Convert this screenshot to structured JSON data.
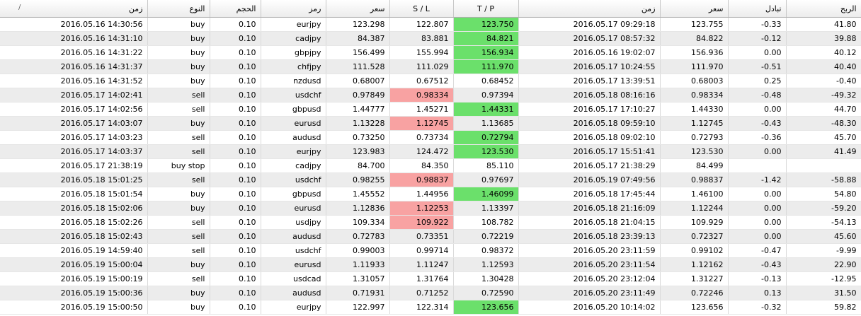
{
  "colors": {
    "tp_hit": "#6be06b",
    "sl_hit": "#f8a2a2",
    "row_alt": "#ececec"
  },
  "headers": {
    "open_time": "زمن",
    "type": "النوع",
    "volume": "الحجم",
    "symbol": "رمز",
    "open_price": "سعر",
    "sl": "S / L",
    "tp": "T / P",
    "close_time": "زمن",
    "close_price": "سعر",
    "swap": "تبادل",
    "profit": "الربح"
  },
  "sort_indicator": "/",
  "rows": [
    {
      "open_time": "2016.05.16 14:30:56",
      "type": "buy",
      "volume": "0.10",
      "symbol": "eurjpy",
      "open_price": "123.298",
      "sl": "122.807",
      "tp": "123.750",
      "close_time": "2016.05.17 09:29:18",
      "close_price": "123.755",
      "swap": "-0.33",
      "profit": "41.80",
      "hit": "tp"
    },
    {
      "open_time": "2016.05.16 14:31:10",
      "type": "buy",
      "volume": "0.10",
      "symbol": "cadjpy",
      "open_price": "84.387",
      "sl": "83.881",
      "tp": "84.821",
      "close_time": "2016.05.17 08:57:32",
      "close_price": "84.822",
      "swap": "-0.12",
      "profit": "39.88",
      "hit": "tp"
    },
    {
      "open_time": "2016.05.16 14:31:22",
      "type": "buy",
      "volume": "0.10",
      "symbol": "gbpjpy",
      "open_price": "156.499",
      "sl": "155.994",
      "tp": "156.934",
      "close_time": "2016.05.16 19:02:07",
      "close_price": "156.936",
      "swap": "0.00",
      "profit": "40.12",
      "hit": "tp"
    },
    {
      "open_time": "2016.05.16 14:31:37",
      "type": "buy",
      "volume": "0.10",
      "symbol": "chfjpy",
      "open_price": "111.528",
      "sl": "111.029",
      "tp": "111.970",
      "close_time": "2016.05.17 10:24:55",
      "close_price": "111.970",
      "swap": "-0.51",
      "profit": "40.40",
      "hit": "tp"
    },
    {
      "open_time": "2016.05.16 14:31:52",
      "type": "buy",
      "volume": "0.10",
      "symbol": "nzdusd",
      "open_price": "0.68007",
      "sl": "0.67512",
      "tp": "0.68452",
      "close_time": "2016.05.17 13:39:51",
      "close_price": "0.68003",
      "swap": "0.25",
      "profit": "-0.40",
      "hit": ""
    },
    {
      "open_time": "2016.05.17 14:02:41",
      "type": "sell",
      "volume": "0.10",
      "symbol": "usdchf",
      "open_price": "0.97849",
      "sl": "0.98334",
      "tp": "0.97394",
      "close_time": "2016.05.18 08:16:16",
      "close_price": "0.98334",
      "swap": "-0.48",
      "profit": "-49.32",
      "hit": "sl"
    },
    {
      "open_time": "2016.05.17 14:02:56",
      "type": "sell",
      "volume": "0.10",
      "symbol": "gbpusd",
      "open_price": "1.44777",
      "sl": "1.45271",
      "tp": "1.44331",
      "close_time": "2016.05.17 17:10:27",
      "close_price": "1.44330",
      "swap": "0.00",
      "profit": "44.70",
      "hit": "tp"
    },
    {
      "open_time": "2016.05.17 14:03:07",
      "type": "buy",
      "volume": "0.10",
      "symbol": "eurusd",
      "open_price": "1.13228",
      "sl": "1.12745",
      "tp": "1.13685",
      "close_time": "2016.05.18 09:59:10",
      "close_price": "1.12745",
      "swap": "-0.43",
      "profit": "-48.30",
      "hit": "sl"
    },
    {
      "open_time": "2016.05.17 14:03:23",
      "type": "sell",
      "volume": "0.10",
      "symbol": "audusd",
      "open_price": "0.73250",
      "sl": "0.73734",
      "tp": "0.72794",
      "close_time": "2016.05.18 09:02:10",
      "close_price": "0.72793",
      "swap": "-0.36",
      "profit": "45.70",
      "hit": "tp"
    },
    {
      "open_time": "2016.05.17 14:03:37",
      "type": "sell",
      "volume": "0.10",
      "symbol": "eurjpy",
      "open_price": "123.983",
      "sl": "124.472",
      "tp": "123.530",
      "close_time": "2016.05.17 15:51:41",
      "close_price": "123.530",
      "swap": "0.00",
      "profit": "41.49",
      "hit": "tp"
    },
    {
      "open_time": "2016.05.17 21:38:19",
      "type": "buy stop",
      "volume": "0.10",
      "symbol": "cadjpy",
      "open_price": "84.700",
      "sl": "84.350",
      "tp": "85.110",
      "close_time": "2016.05.17 21:38:29",
      "close_price": "84.499",
      "swap": "",
      "profit": "",
      "hit": ""
    },
    {
      "open_time": "2016.05.18 15:01:25",
      "type": "sell",
      "volume": "0.10",
      "symbol": "usdchf",
      "open_price": "0.98255",
      "sl": "0.98837",
      "tp": "0.97697",
      "close_time": "2016.05.19 07:49:56",
      "close_price": "0.98837",
      "swap": "-1.42",
      "profit": "-58.88",
      "hit": "sl"
    },
    {
      "open_time": "2016.05.18 15:01:54",
      "type": "buy",
      "volume": "0.10",
      "symbol": "gbpusd",
      "open_price": "1.45552",
      "sl": "1.44956",
      "tp": "1.46099",
      "close_time": "2016.05.18 17:45:44",
      "close_price": "1.46100",
      "swap": "0.00",
      "profit": "54.80",
      "hit": "tp"
    },
    {
      "open_time": "2016.05.18 15:02:06",
      "type": "buy",
      "volume": "0.10",
      "symbol": "eurusd",
      "open_price": "1.12836",
      "sl": "1.12253",
      "tp": "1.13397",
      "close_time": "2016.05.18 21:16:09",
      "close_price": "1.12244",
      "swap": "0.00",
      "profit": "-59.20",
      "hit": "sl"
    },
    {
      "open_time": "2016.05.18 15:02:26",
      "type": "sell",
      "volume": "0.10",
      "symbol": "usdjpy",
      "open_price": "109.334",
      "sl": "109.922",
      "tp": "108.782",
      "close_time": "2016.05.18 21:04:15",
      "close_price": "109.929",
      "swap": "0.00",
      "profit": "-54.13",
      "hit": "sl"
    },
    {
      "open_time": "2016.05.18 15:02:43",
      "type": "sell",
      "volume": "0.10",
      "symbol": "audusd",
      "open_price": "0.72783",
      "sl": "0.73351",
      "tp": "0.72219",
      "close_time": "2016.05.18 23:39:13",
      "close_price": "0.72327",
      "swap": "0.00",
      "profit": "45.60",
      "hit": ""
    },
    {
      "open_time": "2016.05.19 14:59:40",
      "type": "sell",
      "volume": "0.10",
      "symbol": "usdchf",
      "open_price": "0.99003",
      "sl": "0.99714",
      "tp": "0.98372",
      "close_time": "2016.05.20 23:11:59",
      "close_price": "0.99102",
      "swap": "-0.47",
      "profit": "-9.99",
      "hit": ""
    },
    {
      "open_time": "2016.05.19 15:00:04",
      "type": "buy",
      "volume": "0.10",
      "symbol": "eurusd",
      "open_price": "1.11933",
      "sl": "1.11247",
      "tp": "1.12593",
      "close_time": "2016.05.20 23:11:54",
      "close_price": "1.12162",
      "swap": "-0.43",
      "profit": "22.90",
      "hit": ""
    },
    {
      "open_time": "2016.05.19 15:00:19",
      "type": "sell",
      "volume": "0.10",
      "symbol": "usdcad",
      "open_price": "1.31057",
      "sl": "1.31764",
      "tp": "1.30428",
      "close_time": "2016.05.20 23:12:04",
      "close_price": "1.31227",
      "swap": "-0.13",
      "profit": "-12.95",
      "hit": ""
    },
    {
      "open_time": "2016.05.19 15:00:36",
      "type": "buy",
      "volume": "0.10",
      "symbol": "audusd",
      "open_price": "0.71931",
      "sl": "0.71252",
      "tp": "0.72590",
      "close_time": "2016.05.20 23:11:49",
      "close_price": "0.72246",
      "swap": "0.13",
      "profit": "31.50",
      "hit": ""
    },
    {
      "open_time": "2016.05.19 15:00:50",
      "type": "buy",
      "volume": "0.10",
      "symbol": "eurjpy",
      "open_price": "122.997",
      "sl": "122.314",
      "tp": "123.656",
      "close_time": "2016.05.20 10:14:02",
      "close_price": "123.656",
      "swap": "-0.32",
      "profit": "59.82",
      "hit": "tp"
    }
  ]
}
